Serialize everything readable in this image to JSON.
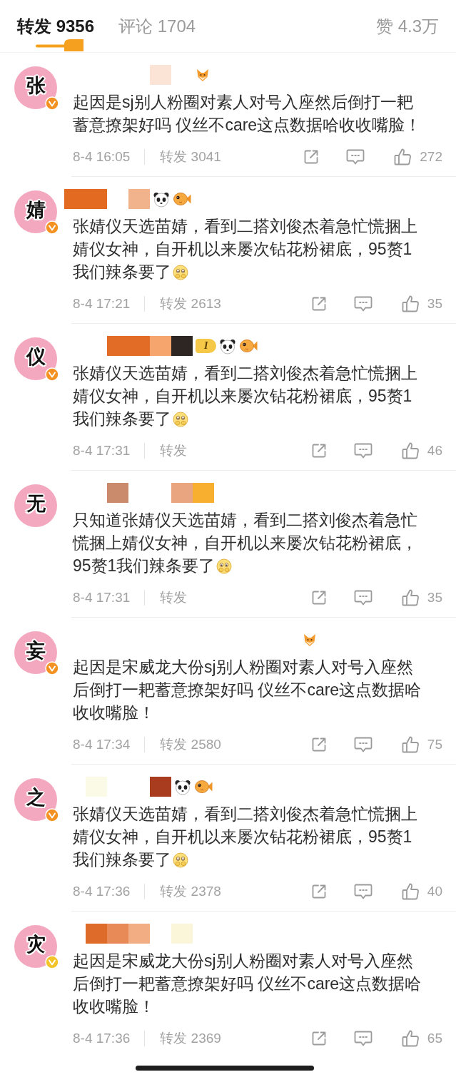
{
  "tabs": [
    {
      "label": "转发 9356",
      "selected": true
    },
    {
      "label": "评论 1704",
      "selected": false
    }
  ],
  "like_tab": {
    "label": "赞 4.3万",
    "selected": false
  },
  "comments": [
    {
      "avatar_text": "张",
      "verified": true,
      "badge": {
        "color": "#f39222"
      },
      "name_row": [
        {
          "kind": "gap"
        },
        {
          "kind": "gap"
        },
        {
          "kind": "gap"
        },
        {
          "kind": "gap"
        },
        {
          "kind": "tile",
          "color": "#fbe4d6"
        },
        {
          "kind": "gap"
        },
        {
          "kind": "fox"
        }
      ],
      "text": "起因是sj别人粉圈对素人对号入座然后倒打一耙蓄意撩架好吗 仪丝不care这点数据哈收收嘴脸！",
      "trailing_emoji": false,
      "time": "8-4 16:05",
      "reposts": "转发 3041",
      "likes": "272"
    },
    {
      "avatar_text": "婧",
      "verified": true,
      "badge": {
        "color": "#f39222"
      },
      "name_row": [
        {
          "kind": "tile",
          "color": "#e36a21"
        },
        {
          "kind": "tile",
          "color": "#e36a21"
        },
        {
          "kind": "gap"
        },
        {
          "kind": "tile",
          "color": "#f1b38c"
        },
        {
          "kind": "panda"
        },
        {
          "kind": "fish"
        }
      ],
      "text": "张婧仪天选苗婧，看到二搭刘俊杰着急忙慌捆上婧仪女神，自开机以来屡次钻花粉裙底，95赘1我们辣条要了",
      "trailing_emoji": true,
      "time": "8-4 17:21",
      "reposts": "转发 2613",
      "likes": "35"
    },
    {
      "avatar_text": "仪",
      "verified": true,
      "badge": {
        "color": "#f39222"
      },
      "name_row": [
        {
          "kind": "gap"
        },
        {
          "kind": "gap"
        },
        {
          "kind": "tile",
          "color": "#e26c25"
        },
        {
          "kind": "tile",
          "color": "#e26c25"
        },
        {
          "kind": "tile",
          "color": "#f6a56c"
        },
        {
          "kind": "tile",
          "color": "#2d2622"
        },
        {
          "kind": "level",
          "label": "I"
        },
        {
          "kind": "panda"
        },
        {
          "kind": "fish"
        }
      ],
      "text": "张婧仪天选苗婧，看到二搭刘俊杰着急忙慌捆上婧仪女神，自开机以来屡次钻花粉裙底，95赘1我们辣条要了",
      "trailing_emoji": true,
      "time": "8-4 17:31",
      "reposts": "转发",
      "likes": "46"
    },
    {
      "avatar_text": "无",
      "verified": false,
      "name_row": [
        {
          "kind": "gap"
        },
        {
          "kind": "gap"
        },
        {
          "kind": "tile",
          "color": "#c98b6b"
        },
        {
          "kind": "gap"
        },
        {
          "kind": "gap"
        },
        {
          "kind": "tile",
          "color": "#e9a57f"
        },
        {
          "kind": "tile",
          "color": "#f8ae2e"
        }
      ],
      "text": "只知道张婧仪天选苗婧，看到二搭刘俊杰着急忙慌捆上婧仪女神，自开机以来屡次钻花粉裙底，95赘1我们辣条要了",
      "trailing_emoji": true,
      "time": "8-4 17:31",
      "reposts": "转发",
      "likes": "35"
    },
    {
      "avatar_text": "妄",
      "verified": true,
      "badge": {
        "color": "#f39222"
      },
      "name_row": [
        {
          "kind": "gap"
        },
        {
          "kind": "gap"
        },
        {
          "kind": "gap"
        },
        {
          "kind": "gap"
        },
        {
          "kind": "gap"
        },
        {
          "kind": "gap"
        },
        {
          "kind": "gap"
        },
        {
          "kind": "gap"
        },
        {
          "kind": "gap"
        },
        {
          "kind": "gap"
        },
        {
          "kind": "gap"
        },
        {
          "kind": "fox"
        }
      ],
      "text": "起因是宋威龙大份sj别人粉圈对素人对号入座然后倒打一耙蓄意撩架好吗 仪丝不care这点数据哈收收嘴脸！",
      "trailing_emoji": false,
      "time": "8-4 17:34",
      "reposts": "转发 2580",
      "likes": "75"
    },
    {
      "avatar_text": "之",
      "verified": true,
      "badge": {
        "color": "#f39222"
      },
      "name_row": [
        {
          "kind": "gap"
        },
        {
          "kind": "tile",
          "color": "#fbfae6"
        },
        {
          "kind": "gap"
        },
        {
          "kind": "gap"
        },
        {
          "kind": "tile",
          "color": "#a93c1f"
        },
        {
          "kind": "panda"
        },
        {
          "kind": "fish"
        }
      ],
      "text": "张婧仪天选苗婧，看到二搭刘俊杰着急忙慌捆上婧仪女神，自开机以来屡次钻花粉裙底，95赘1我们辣条要了",
      "trailing_emoji": true,
      "time": "8-4 17:36",
      "reposts": "转发 2378",
      "likes": "40"
    },
    {
      "avatar_text": "灾",
      "verified": true,
      "badge": {
        "color": "#f2c42a"
      },
      "name_row": [
        {
          "kind": "gap"
        },
        {
          "kind": "tile",
          "color": "#de6b2a"
        },
        {
          "kind": "tile",
          "color": "#e88a57"
        },
        {
          "kind": "tile",
          "color": "#f3ad83"
        },
        {
          "kind": "gap"
        },
        {
          "kind": "tile",
          "color": "#fbf5da"
        }
      ],
      "text": "起因是宋威龙大份sj别人粉圈对素人对号入座然后倒打一耙蓄意撩架好吗 仪丝不care这点数据哈收收嘴脸！",
      "trailing_emoji": false,
      "time": "8-4 17:36",
      "reposts": "转发 2369",
      "likes": "65"
    }
  ]
}
